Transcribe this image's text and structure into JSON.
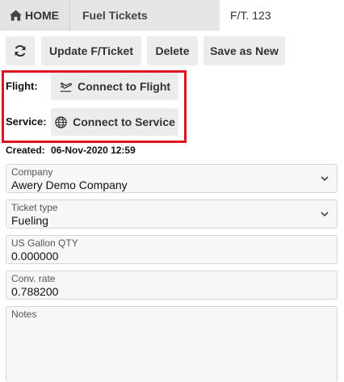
{
  "tabs": {
    "home": "HOME",
    "fuel_tickets": "Fuel Tickets",
    "current": "F/T. 123"
  },
  "toolbar": {
    "refresh_icon": "refresh-icon",
    "update": "Update F/Ticket",
    "delete": "Delete",
    "save_as_new": "Save as New"
  },
  "connect": {
    "flight_label": "Flight:",
    "flight_button": "Connect to Flight",
    "service_label": "Service:",
    "service_button": "Connect to Service",
    "highlight_color": "#e0141e"
  },
  "created": {
    "label": "Created:",
    "value": "06-Nov-2020 12:59"
  },
  "form": {
    "company": {
      "label": "Company",
      "value": "Awery Demo Company"
    },
    "ticket_type": {
      "label": "Ticket type",
      "value": "Fueling"
    },
    "gallon_qty": {
      "label": "US Gallon QTY",
      "value": "0.000000"
    },
    "conv_rate": {
      "label": "Conv. rate",
      "value": "0.788200"
    },
    "notes": {
      "label": "Notes",
      "value": ""
    }
  }
}
